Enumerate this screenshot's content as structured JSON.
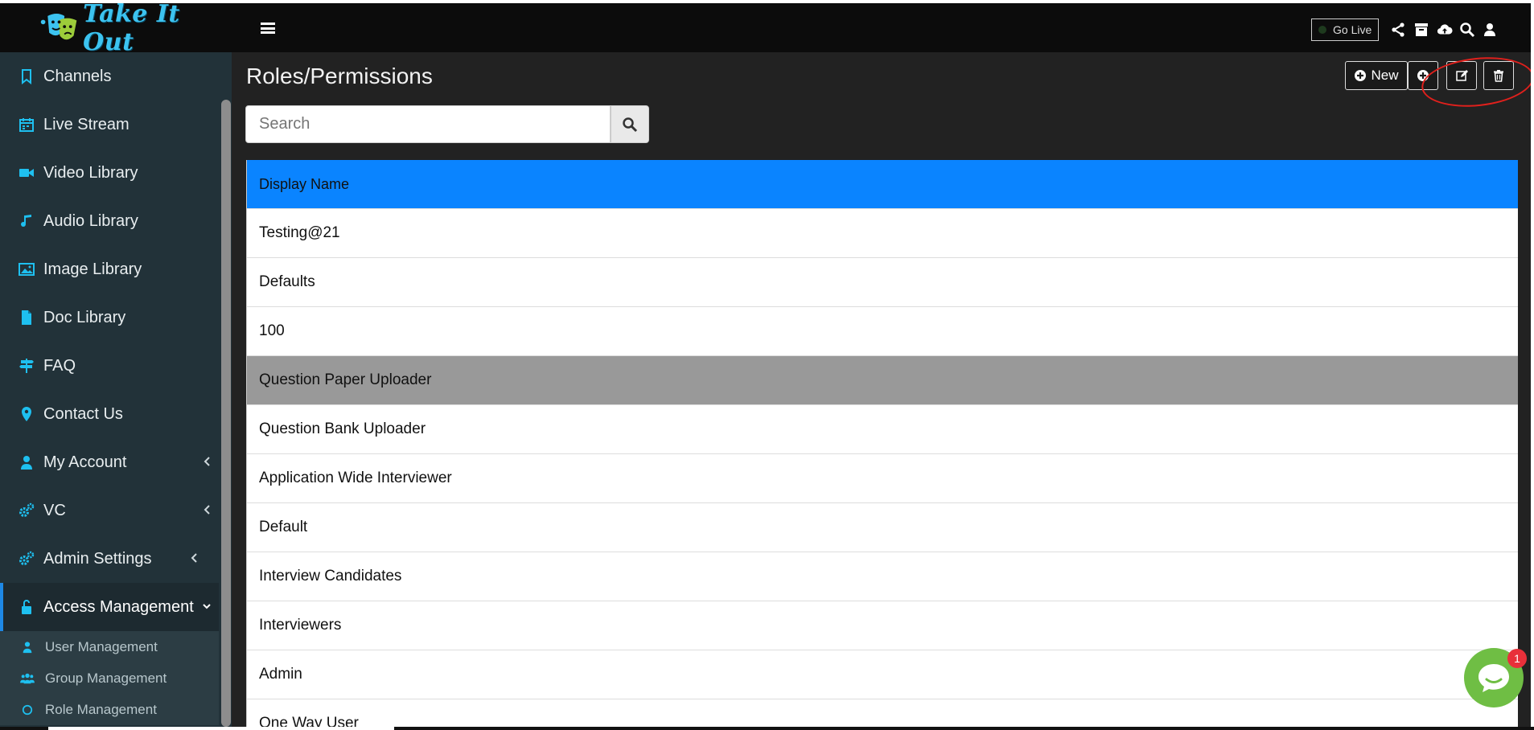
{
  "app": {
    "logo_text": "Take It Out"
  },
  "sidebar": {
    "items": [
      {
        "label": "Channels",
        "icon": "bookmark-icon"
      },
      {
        "label": "Live Stream",
        "icon": "calendar-icon"
      },
      {
        "label": "Video Library",
        "icon": "video-camera-icon"
      },
      {
        "label": "Audio Library",
        "icon": "music-note-icon"
      },
      {
        "label": "Image Library",
        "icon": "image-icon"
      },
      {
        "label": "Doc Library",
        "icon": "document-icon"
      },
      {
        "label": "FAQ",
        "icon": "signpost-icon"
      },
      {
        "label": "Contact Us",
        "icon": "map-pin-icon"
      },
      {
        "label": "My Account",
        "icon": "user-icon"
      },
      {
        "label": "VC",
        "icon": "gears-icon"
      },
      {
        "label": "Admin Settings",
        "icon": "gears-icon"
      },
      {
        "label": "Access Management",
        "icon": "unlock-icon"
      }
    ],
    "subitems": [
      {
        "label": "User Management",
        "icon": "user-icon"
      },
      {
        "label": "Group Management",
        "icon": "users-icon"
      },
      {
        "label": "Role Management",
        "icon": "circle-icon"
      }
    ]
  },
  "topbar": {
    "go_live_label": "Go Live"
  },
  "page": {
    "title": "Roles/Permissions",
    "new_button_label": "New",
    "search_placeholder": "Search"
  },
  "table": {
    "header": "Display Name",
    "rows": [
      "Testing@21",
      "Defaults",
      "100",
      "Question Paper Uploader",
      "Question Bank Uploader",
      "Application Wide Interviewer",
      "Default",
      "Interview Candidates",
      "Interviewers",
      "Admin",
      "One Way User"
    ],
    "selected_row": "Question Paper Uploader"
  },
  "chat": {
    "badge_count": "1"
  },
  "colors": {
    "accent": "#0a84ff",
    "sidebar_bg": "#223239",
    "icon_cyan": "#1ec0f0",
    "chat_green": "#6fbe44",
    "annotation_red": "#e0201c"
  }
}
